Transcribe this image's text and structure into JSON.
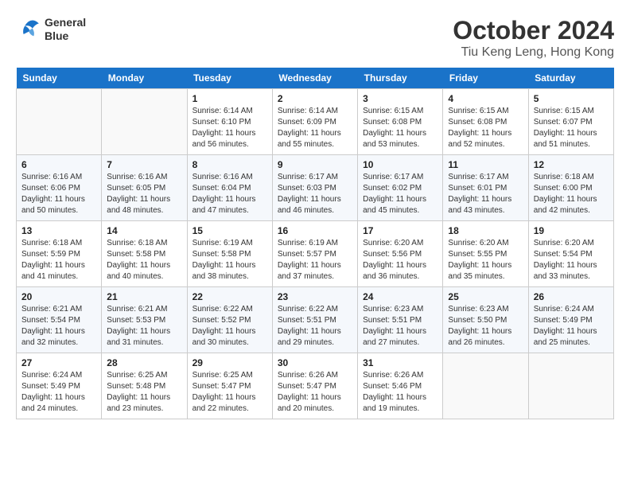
{
  "header": {
    "logo_line1": "General",
    "logo_line2": "Blue",
    "month": "October 2024",
    "location": "Tiu Keng Leng, Hong Kong"
  },
  "columns": [
    "Sunday",
    "Monday",
    "Tuesday",
    "Wednesday",
    "Thursday",
    "Friday",
    "Saturday"
  ],
  "weeks": [
    [
      {
        "day": "",
        "sunrise": "",
        "sunset": "",
        "daylight": ""
      },
      {
        "day": "",
        "sunrise": "",
        "sunset": "",
        "daylight": ""
      },
      {
        "day": "1",
        "sunrise": "Sunrise: 6:14 AM",
        "sunset": "Sunset: 6:10 PM",
        "daylight": "Daylight: 11 hours and 56 minutes."
      },
      {
        "day": "2",
        "sunrise": "Sunrise: 6:14 AM",
        "sunset": "Sunset: 6:09 PM",
        "daylight": "Daylight: 11 hours and 55 minutes."
      },
      {
        "day": "3",
        "sunrise": "Sunrise: 6:15 AM",
        "sunset": "Sunset: 6:08 PM",
        "daylight": "Daylight: 11 hours and 53 minutes."
      },
      {
        "day": "4",
        "sunrise": "Sunrise: 6:15 AM",
        "sunset": "Sunset: 6:08 PM",
        "daylight": "Daylight: 11 hours and 52 minutes."
      },
      {
        "day": "5",
        "sunrise": "Sunrise: 6:15 AM",
        "sunset": "Sunset: 6:07 PM",
        "daylight": "Daylight: 11 hours and 51 minutes."
      }
    ],
    [
      {
        "day": "6",
        "sunrise": "Sunrise: 6:16 AM",
        "sunset": "Sunset: 6:06 PM",
        "daylight": "Daylight: 11 hours and 50 minutes."
      },
      {
        "day": "7",
        "sunrise": "Sunrise: 6:16 AM",
        "sunset": "Sunset: 6:05 PM",
        "daylight": "Daylight: 11 hours and 48 minutes."
      },
      {
        "day": "8",
        "sunrise": "Sunrise: 6:16 AM",
        "sunset": "Sunset: 6:04 PM",
        "daylight": "Daylight: 11 hours and 47 minutes."
      },
      {
        "day": "9",
        "sunrise": "Sunrise: 6:17 AM",
        "sunset": "Sunset: 6:03 PM",
        "daylight": "Daylight: 11 hours and 46 minutes."
      },
      {
        "day": "10",
        "sunrise": "Sunrise: 6:17 AM",
        "sunset": "Sunset: 6:02 PM",
        "daylight": "Daylight: 11 hours and 45 minutes."
      },
      {
        "day": "11",
        "sunrise": "Sunrise: 6:17 AM",
        "sunset": "Sunset: 6:01 PM",
        "daylight": "Daylight: 11 hours and 43 minutes."
      },
      {
        "day": "12",
        "sunrise": "Sunrise: 6:18 AM",
        "sunset": "Sunset: 6:00 PM",
        "daylight": "Daylight: 11 hours and 42 minutes."
      }
    ],
    [
      {
        "day": "13",
        "sunrise": "Sunrise: 6:18 AM",
        "sunset": "Sunset: 5:59 PM",
        "daylight": "Daylight: 11 hours and 41 minutes."
      },
      {
        "day": "14",
        "sunrise": "Sunrise: 6:18 AM",
        "sunset": "Sunset: 5:58 PM",
        "daylight": "Daylight: 11 hours and 40 minutes."
      },
      {
        "day": "15",
        "sunrise": "Sunrise: 6:19 AM",
        "sunset": "Sunset: 5:58 PM",
        "daylight": "Daylight: 11 hours and 38 minutes."
      },
      {
        "day": "16",
        "sunrise": "Sunrise: 6:19 AM",
        "sunset": "Sunset: 5:57 PM",
        "daylight": "Daylight: 11 hours and 37 minutes."
      },
      {
        "day": "17",
        "sunrise": "Sunrise: 6:20 AM",
        "sunset": "Sunset: 5:56 PM",
        "daylight": "Daylight: 11 hours and 36 minutes."
      },
      {
        "day": "18",
        "sunrise": "Sunrise: 6:20 AM",
        "sunset": "Sunset: 5:55 PM",
        "daylight": "Daylight: 11 hours and 35 minutes."
      },
      {
        "day": "19",
        "sunrise": "Sunrise: 6:20 AM",
        "sunset": "Sunset: 5:54 PM",
        "daylight": "Daylight: 11 hours and 33 minutes."
      }
    ],
    [
      {
        "day": "20",
        "sunrise": "Sunrise: 6:21 AM",
        "sunset": "Sunset: 5:54 PM",
        "daylight": "Daylight: 11 hours and 32 minutes."
      },
      {
        "day": "21",
        "sunrise": "Sunrise: 6:21 AM",
        "sunset": "Sunset: 5:53 PM",
        "daylight": "Daylight: 11 hours and 31 minutes."
      },
      {
        "day": "22",
        "sunrise": "Sunrise: 6:22 AM",
        "sunset": "Sunset: 5:52 PM",
        "daylight": "Daylight: 11 hours and 30 minutes."
      },
      {
        "day": "23",
        "sunrise": "Sunrise: 6:22 AM",
        "sunset": "Sunset: 5:51 PM",
        "daylight": "Daylight: 11 hours and 29 minutes."
      },
      {
        "day": "24",
        "sunrise": "Sunrise: 6:23 AM",
        "sunset": "Sunset: 5:51 PM",
        "daylight": "Daylight: 11 hours and 27 minutes."
      },
      {
        "day": "25",
        "sunrise": "Sunrise: 6:23 AM",
        "sunset": "Sunset: 5:50 PM",
        "daylight": "Daylight: 11 hours and 26 minutes."
      },
      {
        "day": "26",
        "sunrise": "Sunrise: 6:24 AM",
        "sunset": "Sunset: 5:49 PM",
        "daylight": "Daylight: 11 hours and 25 minutes."
      }
    ],
    [
      {
        "day": "27",
        "sunrise": "Sunrise: 6:24 AM",
        "sunset": "Sunset: 5:49 PM",
        "daylight": "Daylight: 11 hours and 24 minutes."
      },
      {
        "day": "28",
        "sunrise": "Sunrise: 6:25 AM",
        "sunset": "Sunset: 5:48 PM",
        "daylight": "Daylight: 11 hours and 23 minutes."
      },
      {
        "day": "29",
        "sunrise": "Sunrise: 6:25 AM",
        "sunset": "Sunset: 5:47 PM",
        "daylight": "Daylight: 11 hours and 22 minutes."
      },
      {
        "day": "30",
        "sunrise": "Sunrise: 6:26 AM",
        "sunset": "Sunset: 5:47 PM",
        "daylight": "Daylight: 11 hours and 20 minutes."
      },
      {
        "day": "31",
        "sunrise": "Sunrise: 6:26 AM",
        "sunset": "Sunset: 5:46 PM",
        "daylight": "Daylight: 11 hours and 19 minutes."
      },
      {
        "day": "",
        "sunrise": "",
        "sunset": "",
        "daylight": ""
      },
      {
        "day": "",
        "sunrise": "",
        "sunset": "",
        "daylight": ""
      }
    ]
  ]
}
